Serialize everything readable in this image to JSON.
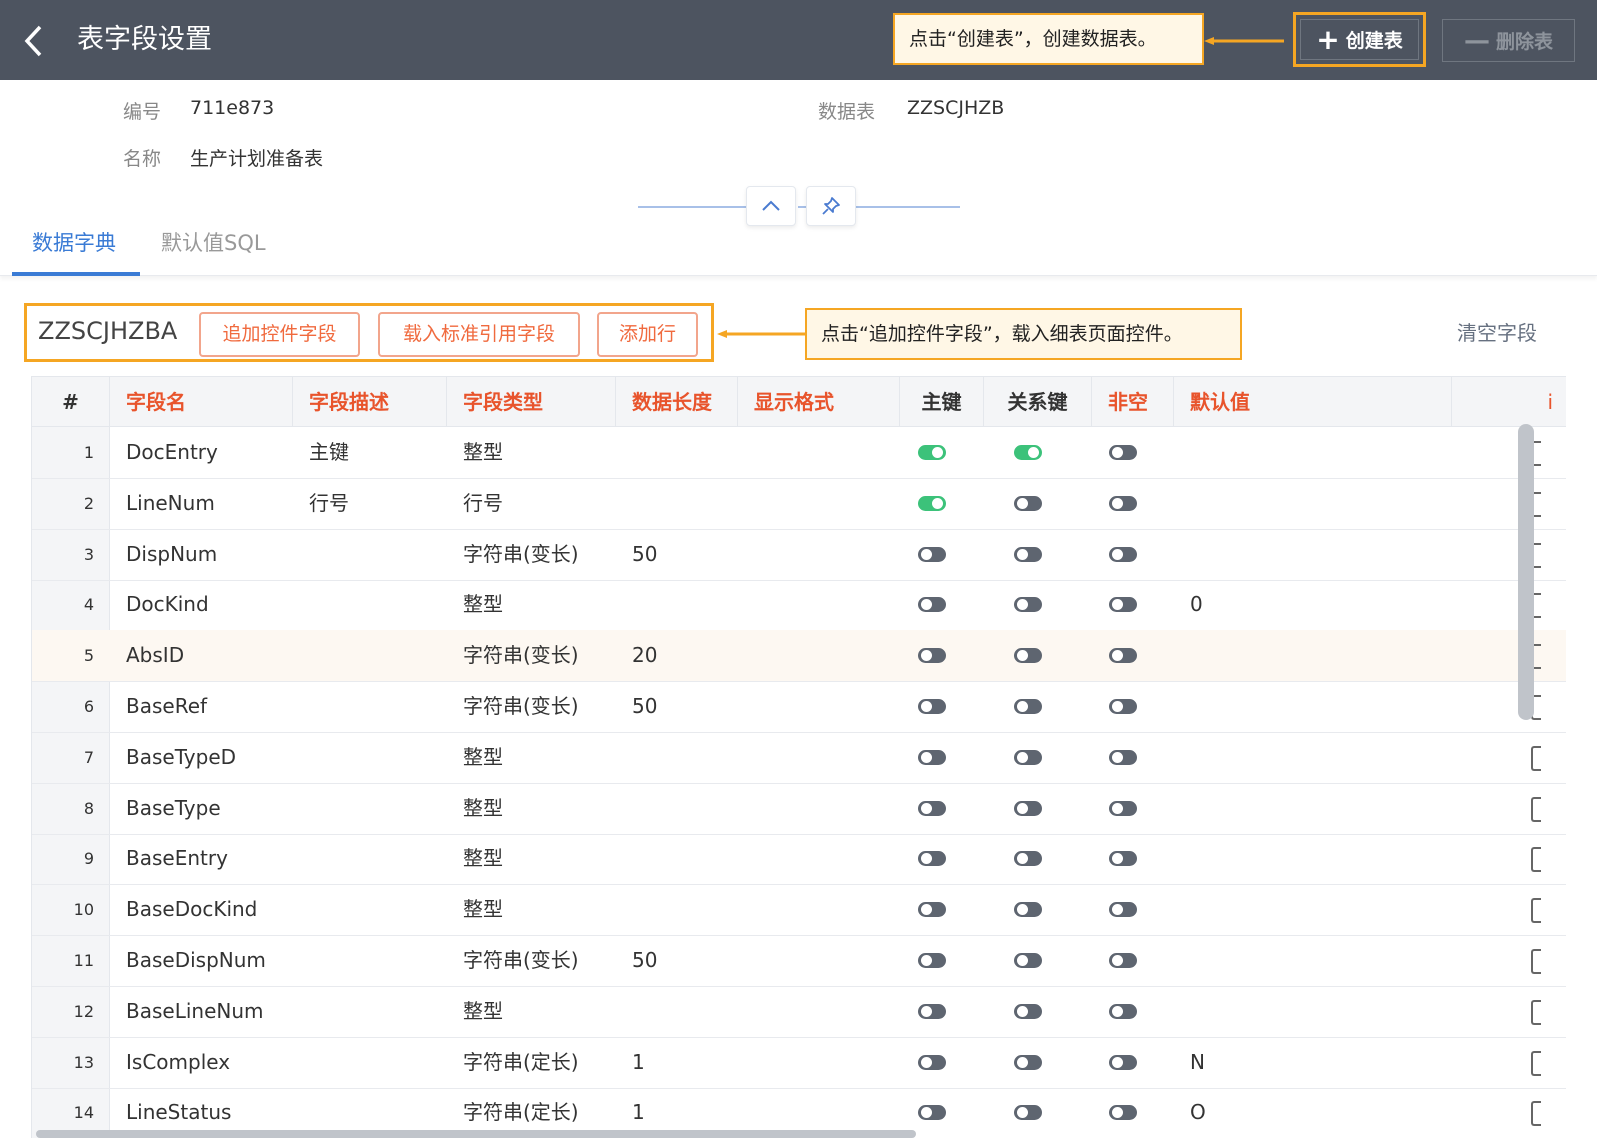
{
  "header": {
    "title": "表字段设置",
    "callout": "点击“创建表”，创建数据表。",
    "create_label": "创建表",
    "delete_label": "删除表"
  },
  "info": {
    "code_label": "编号",
    "code_value": "711e873",
    "table_label": "数据表",
    "table_value": "ZZSCJHZB",
    "name_label": "名称",
    "name_value": "生产计划准备表"
  },
  "tabs": [
    {
      "label": "数据字典",
      "active": true
    },
    {
      "label": "默认值SQL",
      "active": false
    }
  ],
  "toolbar": {
    "table_code": "ZZSCJHZBA",
    "add_control_label": "追加控件字段",
    "load_standard_label": "载入标准引用字段",
    "add_row_label": "添加行",
    "callout": "点击“追加控件字段”，载入细表页面控件。",
    "clear_label": "清空字段"
  },
  "table": {
    "columns": [
      {
        "key": "idx",
        "label": "#"
      },
      {
        "key": "name",
        "label": "字段名"
      },
      {
        "key": "desc",
        "label": "字段描述"
      },
      {
        "key": "type",
        "label": "字段类型"
      },
      {
        "key": "length",
        "label": "数据长度"
      },
      {
        "key": "format",
        "label": "显示格式"
      },
      {
        "key": "pk",
        "label": "主键"
      },
      {
        "key": "fk",
        "label": "关系键"
      },
      {
        "key": "notnull",
        "label": "非空"
      },
      {
        "key": "default",
        "label": "默认值"
      },
      {
        "key": "more",
        "label": "i"
      }
    ],
    "rows": [
      {
        "idx": "1",
        "name": "DocEntry",
        "desc": "主键",
        "type": "整型",
        "length": "",
        "format": "",
        "pk": true,
        "fk": true,
        "notnull": false,
        "default": ""
      },
      {
        "idx": "2",
        "name": "LineNum",
        "desc": "行号",
        "type": "行号",
        "length": "",
        "format": "",
        "pk": true,
        "fk": false,
        "notnull": false,
        "default": ""
      },
      {
        "idx": "3",
        "name": "DispNum",
        "desc": "",
        "type": "字符串(变长)",
        "length": "50",
        "format": "",
        "pk": false,
        "fk": false,
        "notnull": false,
        "default": ""
      },
      {
        "idx": "4",
        "name": "DocKind",
        "desc": "",
        "type": "整型",
        "length": "",
        "format": "",
        "pk": false,
        "fk": false,
        "notnull": false,
        "default": "0"
      },
      {
        "idx": "5",
        "name": "AbsID",
        "desc": "",
        "type": "字符串(变长)",
        "length": "20",
        "format": "",
        "pk": false,
        "fk": false,
        "notnull": false,
        "default": "",
        "highlight": true
      },
      {
        "idx": "6",
        "name": "BaseRef",
        "desc": "",
        "type": "字符串(变长)",
        "length": "50",
        "format": "",
        "pk": false,
        "fk": false,
        "notnull": false,
        "default": ""
      },
      {
        "idx": "7",
        "name": "BaseTypeD",
        "desc": "",
        "type": "整型",
        "length": "",
        "format": "",
        "pk": false,
        "fk": false,
        "notnull": false,
        "default": ""
      },
      {
        "idx": "8",
        "name": "BaseType",
        "desc": "",
        "type": "整型",
        "length": "",
        "format": "",
        "pk": false,
        "fk": false,
        "notnull": false,
        "default": ""
      },
      {
        "idx": "9",
        "name": "BaseEntry",
        "desc": "",
        "type": "整型",
        "length": "",
        "format": "",
        "pk": false,
        "fk": false,
        "notnull": false,
        "default": ""
      },
      {
        "idx": "10",
        "name": "BaseDocKind",
        "desc": "",
        "type": "整型",
        "length": "",
        "format": "",
        "pk": false,
        "fk": false,
        "notnull": false,
        "default": ""
      },
      {
        "idx": "11",
        "name": "BaseDispNum",
        "desc": "",
        "type": "字符串(变长)",
        "length": "50",
        "format": "",
        "pk": false,
        "fk": false,
        "notnull": false,
        "default": ""
      },
      {
        "idx": "12",
        "name": "BaseLineNum",
        "desc": "",
        "type": "整型",
        "length": "",
        "format": "",
        "pk": false,
        "fk": false,
        "notnull": false,
        "default": ""
      },
      {
        "idx": "13",
        "name": "IsComplex",
        "desc": "",
        "type": "字符串(定长)",
        "length": "1",
        "format": "",
        "pk": false,
        "fk": false,
        "notnull": false,
        "default": "N"
      },
      {
        "idx": "14",
        "name": "LineStatus",
        "desc": "",
        "type": "字符串(定长)",
        "length": "1",
        "format": "",
        "pk": false,
        "fk": false,
        "notnull": false,
        "default": "O"
      }
    ]
  },
  "colors": {
    "header_bg": "#4d5460",
    "accent": "#3a7bd5",
    "highlight_border": "#f5a623",
    "toggle_on": "#3cc27a",
    "toggle_off": "#5e6570",
    "column_red": "#e8542c"
  }
}
